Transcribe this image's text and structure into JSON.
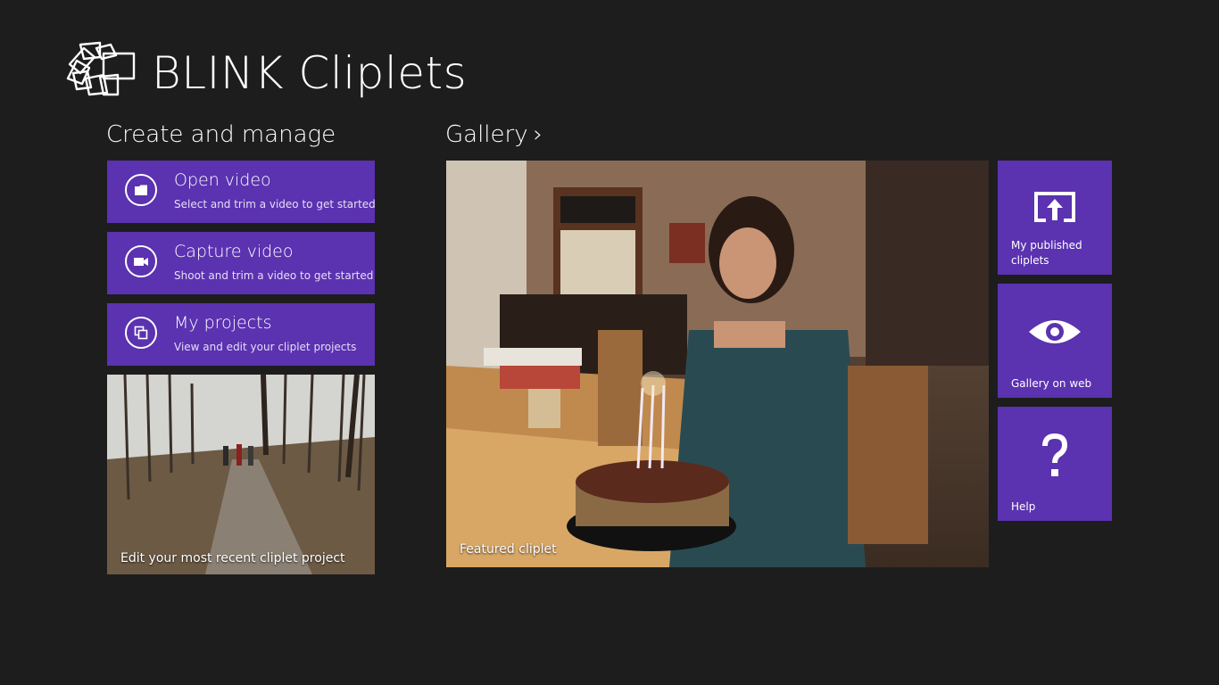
{
  "app": {
    "title": "BLINK Cliplets"
  },
  "create": {
    "heading": "Create and manage",
    "actions": [
      {
        "title": "Open video",
        "subtitle": "Select and trim a video to get started",
        "icon": "folder-icon"
      },
      {
        "title": "Capture video",
        "subtitle": "Shoot and trim a video to get started",
        "icon": "camera-icon"
      },
      {
        "title": "My projects",
        "subtitle": "View and edit your cliplet projects",
        "icon": "projects-icon"
      }
    ],
    "recent_caption": "Edit your most recent cliplet project"
  },
  "gallery": {
    "heading": "Gallery",
    "chevron": "›",
    "featured_caption": "Featured cliplet",
    "side_tiles": [
      {
        "label": "My published cliplets",
        "icon": "upload-icon"
      },
      {
        "label": "Gallery on web",
        "icon": "eye-icon"
      },
      {
        "label": "Help",
        "icon": "question-icon"
      }
    ]
  },
  "colors": {
    "background": "#1d1d1d",
    "accent": "#5b32b0",
    "text": "#ffffff"
  }
}
